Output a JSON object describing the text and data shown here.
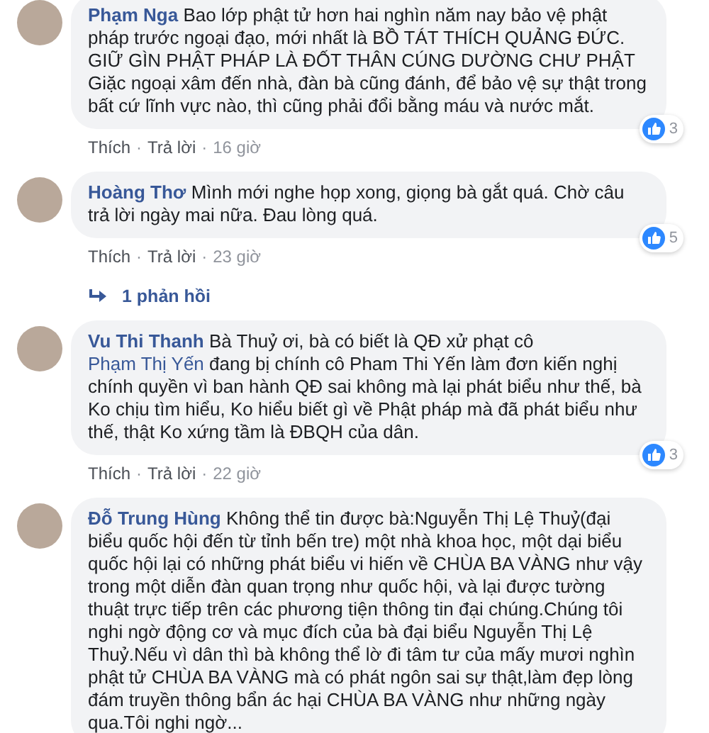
{
  "comments": [
    {
      "author": "Phạm Nga",
      "parts": [
        {
          "kind": "text",
          "text": "Bao lớp phật tử hơn hai nghìn năm nay bảo vệ phật pháp trước ngoại đạo, mới nhất là BỒ TÁT THÍCH QUẢNG ĐỨC. GIỮ GÌN PHẬT PHÁP LÀ ĐỐT THÂN CÚNG DƯỜNG CHƯ PHẬT Giặc ngoại xâm đến nhà, đàn bà cũng đánh, để bảo vệ sự thật trong bất cứ lĩnh vực nào, thì cũng phải đổi bằng máu và nước mắt."
        }
      ],
      "like_count": "3",
      "actions": [
        {
          "kind": "link",
          "text": "Thích"
        },
        {
          "kind": "separator",
          "text": "·"
        },
        {
          "kind": "link",
          "text": "Trả lời"
        },
        {
          "kind": "separator",
          "text": "·"
        },
        {
          "kind": "time",
          "text": "16 giờ"
        }
      ]
    },
    {
      "author": "Hoàng Thơ",
      "parts": [
        {
          "kind": "text",
          "text": "Mình mới nghe họp xong, giọng bà gắt quá. Chờ câu trả lời ngày mai nữa. Đau lòng quá."
        }
      ],
      "like_count": "5",
      "actions": [
        {
          "kind": "link",
          "text": "Thích"
        },
        {
          "kind": "separator",
          "text": "·"
        },
        {
          "kind": "link",
          "text": "Trả lời"
        },
        {
          "kind": "separator",
          "text": "·"
        },
        {
          "kind": "time",
          "text": "23 giờ"
        }
      ],
      "replies_link": "1 phản hồi"
    },
    {
      "author": "Vu Thi Thanh",
      "parts": [
        {
          "kind": "text",
          "text": "Bà Thuỷ ơi, bà có biết là QĐ xử phạt cô "
        },
        {
          "kind": "mention",
          "text": "Phạm Thị Yến"
        },
        {
          "kind": "text",
          "text": " đang bị chính cô Pham Thi Yến làm đơn kiến nghị chính quyền vì ban hành QĐ sai không mà lại phát biểu như thế, bà Ko chịu tìm hiểu, Ko hiểu biết gì về Phật pháp mà đã phát biểu như thế, thật Ko xứng tầm là ĐBQH của dân."
        }
      ],
      "like_count": "3",
      "actions": [
        {
          "kind": "link",
          "text": "Thích"
        },
        {
          "kind": "separator",
          "text": "·"
        },
        {
          "kind": "link",
          "text": "Trả lời"
        },
        {
          "kind": "separator",
          "text": "·"
        },
        {
          "kind": "time",
          "text": "22 giờ"
        }
      ]
    },
    {
      "author": "Đỗ Trung Hùng",
      "parts": [
        {
          "kind": "text",
          "text": "Không thể tin được bà:Nguyễn Thị Lệ Thuỷ(đại biểu quốc hội đến từ tỉnh bến tre) một nhà khoa học, một dại biểu quốc hội lại có những phát biểu vi hiến về CHÙA BA VÀNG như vậy trong một diễn đàn quan trọng như quốc hội, và lại được tường thuật trực tiếp trên các phương tiện thông tin đại chúng.Chúng tôi nghi ngờ động cơ và mục đích của bà đại biểu Nguyễn Thị Lệ Thuỷ.Nếu vì dân thì bà không thể lờ đi tâm tư của mấy mươi nghìn phật tử CHÙA BA VÀNG mà có phát ngôn sai sự thật,làm đẹp lòng đám truyền thông bẩn ác hại CHÙA BA VÀNG như những ngày qua.Tôi nghi ngờ..."
        }
      ]
    }
  ]
}
